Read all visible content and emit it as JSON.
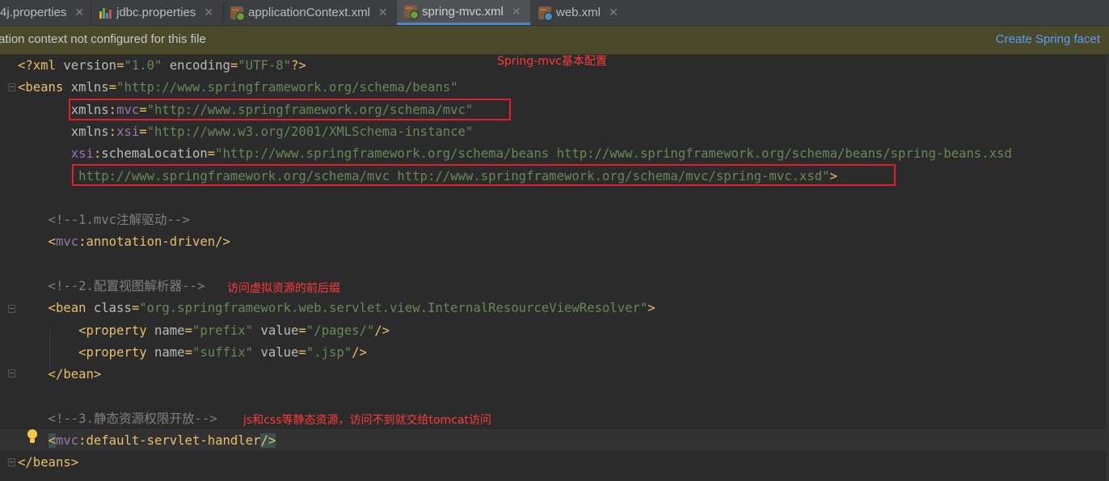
{
  "tabs": [
    {
      "label": "4j.properties",
      "icon": "properties-file-icon"
    },
    {
      "label": "jdbc.properties",
      "icon": "properties-file-icon"
    },
    {
      "label": "applicationContext.xml",
      "icon": "spring-xml-file-icon"
    },
    {
      "label": "spring-mvc.xml",
      "icon": "spring-xml-file-icon",
      "active": true
    },
    {
      "label": "web.xml",
      "icon": "web-xml-file-icon"
    }
  ],
  "close_glyph": "✕",
  "banner": {
    "message": "ation context not configured for this file",
    "action": "Create Spring facet"
  },
  "code_lines": [
    [
      [
        "t",
        "<?xml "
      ],
      [
        "a",
        "version"
      ],
      [
        "t",
        "="
      ],
      [
        "s",
        "\"1.0\""
      ],
      [
        "a",
        " encoding"
      ],
      [
        "t",
        "="
      ],
      [
        "s",
        "\"UTF-8\""
      ],
      [
        "t",
        "?>"
      ]
    ],
    [
      [
        "t",
        "<beans "
      ],
      [
        "a",
        "xmlns"
      ],
      [
        "t",
        "="
      ],
      [
        "s",
        "\"http://www.springframework.org/schema/beans\""
      ]
    ],
    [
      [
        "a",
        "       xmlns"
      ],
      [
        "t",
        ":"
      ],
      [
        "ns",
        "mvc"
      ],
      [
        "t",
        "="
      ],
      [
        "s",
        "\"http://www.springframework.org/schema/mvc\""
      ]
    ],
    [
      [
        "a",
        "       xmlns"
      ],
      [
        "t",
        ":"
      ],
      [
        "ns",
        "xsi"
      ],
      [
        "t",
        "="
      ],
      [
        "s",
        "\"http://www.w3.org/2001/XMLSchema-instance\""
      ]
    ],
    [
      [
        "ns",
        "       xsi"
      ],
      [
        "t",
        ":"
      ],
      [
        "a",
        "schemaLocation"
      ],
      [
        "t",
        "="
      ],
      [
        "s",
        "\"http://www.springframework.org/schema/beans http://www.springframework.org/schema/beans/spring-beans.xsd"
      ]
    ],
    [
      [
        "s",
        "        http://www.springframework.org/schema/mvc http://www.springframework.org/schema/mvc/spring-mvc.xsd\""
      ],
      [
        "t",
        ">"
      ]
    ],
    [],
    [
      [
        "c",
        "    <!--1.mvc注解驱动-->"
      ]
    ],
    [
      [
        "t",
        "    <"
      ],
      [
        "ns",
        "mvc"
      ],
      [
        "t",
        ":annotation-driven/>"
      ]
    ],
    [],
    [
      [
        "c",
        "    <!--2.配置视图解析器-->"
      ]
    ],
    [
      [
        "t",
        "    <bean "
      ],
      [
        "a",
        "class"
      ],
      [
        "t",
        "="
      ],
      [
        "s",
        "\"org.springframework.web.servlet.view.InternalResourceViewResolver\""
      ],
      [
        "t",
        ">"
      ]
    ],
    [
      [
        "t",
        "        <property "
      ],
      [
        "a",
        "name"
      ],
      [
        "t",
        "="
      ],
      [
        "s",
        "\"prefix\""
      ],
      [
        "a",
        " value"
      ],
      [
        "t",
        "="
      ],
      [
        "s",
        "\"/pages/\""
      ],
      [
        "t",
        "/>"
      ]
    ],
    [
      [
        "t",
        "        <property "
      ],
      [
        "a",
        "name"
      ],
      [
        "t",
        "="
      ],
      [
        "s",
        "\"suffix\""
      ],
      [
        "a",
        " value"
      ],
      [
        "t",
        "="
      ],
      [
        "s",
        "\".jsp\""
      ],
      [
        "t",
        "/>"
      ]
    ],
    [
      [
        "t",
        "    </bean>"
      ]
    ],
    [],
    [
      [
        "c",
        "    <!--3.静态资源权限开放-->"
      ]
    ],
    [
      [
        "t",
        "    "
      ],
      [
        "tm",
        "<"
      ],
      [
        "ns",
        "mvc"
      ],
      [
        "t",
        ":default-servlet-handler"
      ],
      [
        "tm",
        "/>"
      ]
    ],
    [
      [
        "t",
        "</beans>"
      ]
    ]
  ],
  "annotations": {
    "title": "Spring-mvc基本配置",
    "view_resolver": "访问虚拟资源的前后缀",
    "static_resources": "js和css等静态资源，访问不到就交给tomcat访问"
  },
  "colors": {
    "tag": "#e8bf6a",
    "attribute": "#bababa",
    "namespace": "#9876aa",
    "string": "#6a8759",
    "comment": "#808080",
    "highlight_box": "#e0202a",
    "annotation_text": "#ff3b3b"
  }
}
